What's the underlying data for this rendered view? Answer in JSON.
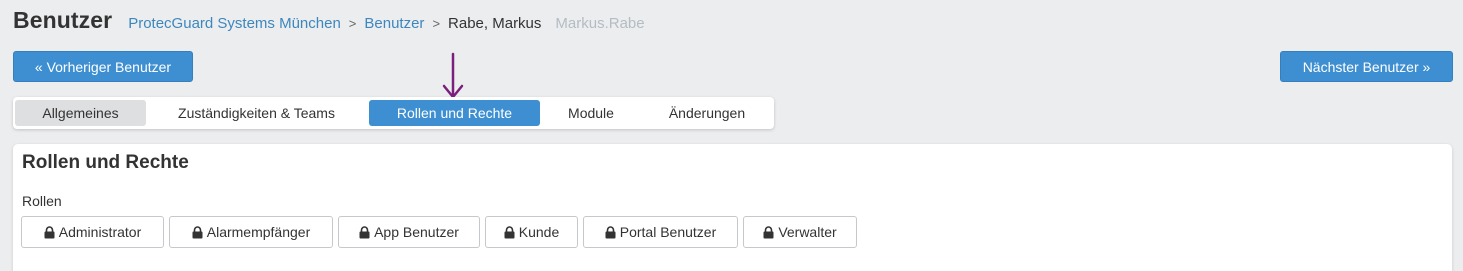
{
  "header": {
    "title": "Benutzer",
    "breadcrumb": {
      "org": "ProtecGuard Systems München",
      "section": "Benutzer",
      "current": "Rabe, Markus",
      "login": "Markus.Rabe",
      "separator": ">"
    }
  },
  "nav": {
    "prev_label": "« Vorheriger Benutzer",
    "next_label": "Nächster Benutzer »"
  },
  "tabs": [
    {
      "label": "Allgemeines"
    },
    {
      "label": "Zuständigkeiten & Teams"
    },
    {
      "label": "Rollen und Rechte"
    },
    {
      "label": "Module"
    },
    {
      "label": "Änderungen"
    }
  ],
  "active_tab": "Rollen und Rechte",
  "panel": {
    "title": "Rollen und Rechte",
    "roles_label": "Rollen",
    "roles": [
      {
        "label": "Administrator",
        "icon": "lock-icon"
      },
      {
        "label": "Alarmempfänger",
        "icon": "lock-icon"
      },
      {
        "label": "App Benutzer",
        "icon": "lock-icon"
      },
      {
        "label": "Kunde",
        "icon": "lock-icon"
      },
      {
        "label": "Portal Benutzer",
        "icon": "lock-icon"
      },
      {
        "label": "Verwalter",
        "icon": "lock-icon"
      }
    ]
  },
  "annotation": {
    "icon": "arrow-down-icon",
    "color": "#7b1f7c"
  },
  "colors": {
    "accent": "#3d8fd1",
    "link": "#3d87bd",
    "muted": "#b4bcc4",
    "background": "#ecedef"
  }
}
